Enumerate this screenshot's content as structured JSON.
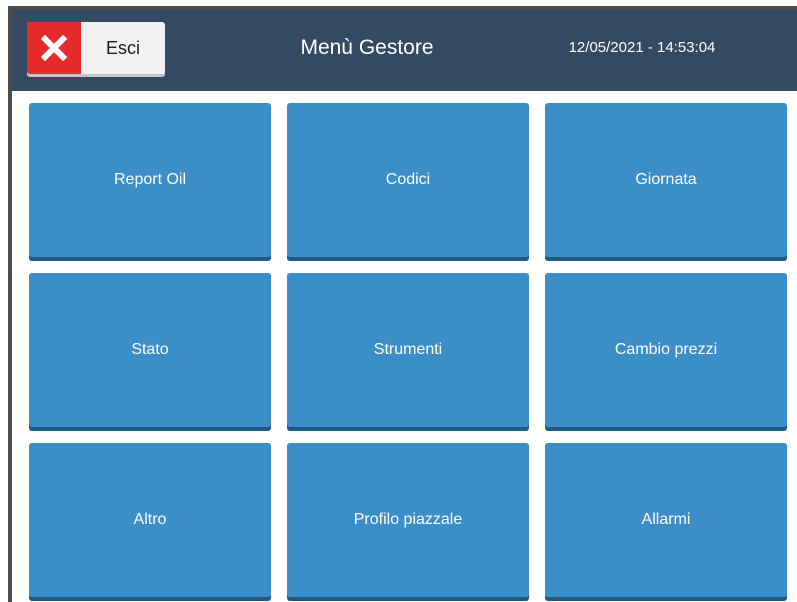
{
  "header": {
    "exit_label": "Esci",
    "title": "Menù Gestore",
    "datetime": "12/05/2021 - 14:53:04"
  },
  "menu": {
    "tiles": [
      {
        "label": "Report Oil"
      },
      {
        "label": "Codici"
      },
      {
        "label": "Giornata"
      },
      {
        "label": "Stato"
      },
      {
        "label": "Strumenti"
      },
      {
        "label": "Cambio prezzi"
      },
      {
        "label": "Altro"
      },
      {
        "label": "Profilo piazzale"
      },
      {
        "label": "Allarmi"
      }
    ]
  },
  "colors": {
    "header_bg": "#334a62",
    "tile_bg": "#3b8ec8",
    "exit_red": "#e52b2b"
  },
  "icons": {
    "exit": "close-icon"
  }
}
